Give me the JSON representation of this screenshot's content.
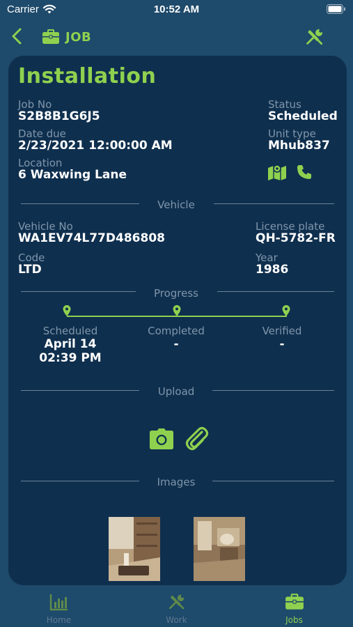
{
  "status_bar": {
    "carrier": "Carrier",
    "time": "10:52 AM"
  },
  "nav": {
    "title": "JOB",
    "back_icon": "chevron-left-icon",
    "title_icon": "briefcase-icon",
    "action_icon": "tools-icon"
  },
  "colors": {
    "accent": "#8fd14f",
    "background": "#1e4a6b",
    "card": "#0f2f4e",
    "muted": "#7f96ab"
  },
  "job": {
    "title": "Installation",
    "job_no_label": "Job No",
    "job_no": "S2B8B1G6J5",
    "status_label": "Status",
    "status": "Scheduled",
    "date_due_label": "Date due",
    "date_due": "2/23/2021 12:00:00 AM",
    "unit_type_label": "Unit type",
    "unit_type": "Mhub837",
    "location_label": "Location",
    "location": "6 Waxwing Lane",
    "map_icon": "map-icon",
    "phone_icon": "phone-icon"
  },
  "vehicle": {
    "section_label": "Vehicle",
    "vehicle_no_label": "Vehicle No",
    "vehicle_no": "WA1EV74L77D486808",
    "license_plate_label": "License plate",
    "license_plate": "QH-5782-FR",
    "code_label": "Code",
    "code": "LTD",
    "year_label": "Year",
    "year": "1986"
  },
  "progress": {
    "section_label": "Progress",
    "steps": [
      {
        "label": "Scheduled",
        "line1": "April 14",
        "line2": "02:39 PM"
      },
      {
        "label": "Completed",
        "line1": "-",
        "line2": ""
      },
      {
        "label": "Verified",
        "line1": "-",
        "line2": ""
      }
    ]
  },
  "upload": {
    "section_label": "Upload",
    "camera_icon": "camera-icon",
    "attach_icon": "paperclip-icon"
  },
  "images": {
    "section_label": "Images"
  },
  "tabs": [
    {
      "label": "Home",
      "icon": "bar-chart-icon",
      "active": false
    },
    {
      "label": "Work",
      "icon": "tools-icon",
      "active": false
    },
    {
      "label": "Jobs",
      "icon": "briefcase-icon",
      "active": true
    }
  ]
}
